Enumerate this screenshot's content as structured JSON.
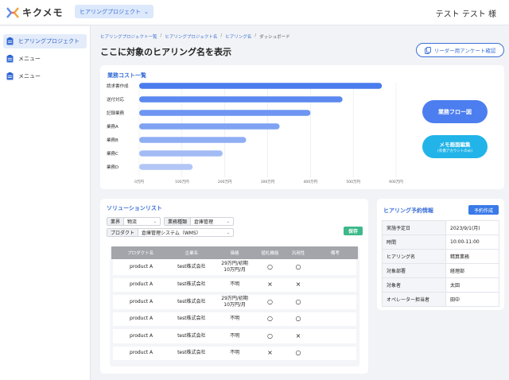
{
  "app": {
    "logo_text": "キクメモ",
    "project_select": "ヒアリングプロジェクト",
    "user_name": "テスト テスト 様"
  },
  "colors": {
    "accent": "#3a6fd8",
    "bar_dark": "#4a7cee",
    "bar_light": "#b3c7f6",
    "save_green": "#3db88a",
    "memo_cyan": "#22b4e8"
  },
  "sidebar": {
    "items": [
      {
        "label": "ヒアリングプロジェクト",
        "icon": "clipboard-icon",
        "active": true
      },
      {
        "label": "メニュー",
        "icon": "clipboard-icon",
        "active": false
      },
      {
        "label": "メニュー",
        "icon": "clipboard-icon",
        "active": false
      }
    ]
  },
  "breadcrumb": [
    "ヒアリングプロジェクト一覧",
    "ヒアリングプロジェクト名",
    "ヒアリング名",
    "ダッシュボード"
  ],
  "page_title": "ここに対象のヒアリング名を表示",
  "survey_button": "リーダー用アンケート確認",
  "cost_panel": {
    "title": "業務コスト一覧"
  },
  "chart_data": {
    "type": "bar",
    "orientation": "horizontal",
    "title": "業務コスト一覧",
    "categories": [
      "請求書作成",
      "送付対応",
      "記録業務",
      "業務A",
      "業務B",
      "業務C",
      "業務D"
    ],
    "values": [
      567,
      475,
      400,
      328,
      250,
      195,
      125
    ],
    "x_ticks": [
      "0万円",
      "100万円",
      "200万円",
      "300万円",
      "400万円",
      "500万円",
      "600万円"
    ],
    "xlim": [
      0,
      600
    ],
    "grid": true
  },
  "flow_button": "業務フロー図",
  "memo_button": {
    "main": "メモ画面編集",
    "sub": "(有償アカウントのみ)"
  },
  "solution": {
    "title": "ソリューションリスト",
    "filters": {
      "industry": {
        "label": "業界",
        "value": "物流"
      },
      "job_type": {
        "label": "業務種類",
        "value": "倉庫管理"
      },
      "product": {
        "label": "プロダクト",
        "value": "倉庫管理システム（WMS）"
      }
    },
    "save_label": "保存",
    "columns": [
      "プロダクト名",
      "企業名",
      "価格",
      "値札機能",
      "汎用性",
      "備考"
    ],
    "rows": [
      {
        "product": "product A",
        "company": "test株式会社",
        "price": "29万円/初期\n10万円/月",
        "tag": "○",
        "versatility": "○",
        "note": ""
      },
      {
        "product": "product A",
        "company": "test株式会社",
        "price": "不明",
        "tag": "×",
        "versatility": "×",
        "note": ""
      },
      {
        "product": "product A",
        "company": "test株式会社",
        "price": "29万円/初期\n10万円/月",
        "tag": "○",
        "versatility": "○",
        "note": ""
      },
      {
        "product": "product A",
        "company": "test株式会社",
        "price": "不明",
        "tag": "○",
        "versatility": "○",
        "note": ""
      },
      {
        "product": "product A",
        "company": "test株式会社",
        "price": "不明",
        "tag": "○",
        "versatility": "×",
        "note": ""
      },
      {
        "product": "product A",
        "company": "test株式会社",
        "price": "不明",
        "tag": "×",
        "versatility": "○",
        "note": ""
      }
    ]
  },
  "schedule": {
    "title": "ヒアリング予約情報",
    "button": "予約作成",
    "rows": [
      {
        "key": "実施予定日",
        "value": "2023/9/1(月)"
      },
      {
        "key": "時間",
        "value": "10:00-11:00"
      },
      {
        "key": "ヒアリング名",
        "value": "精算業務"
      },
      {
        "key": "対象部署",
        "value": "経理部"
      },
      {
        "key": "対象者",
        "value": "太田"
      },
      {
        "key": "オペレーター担当者",
        "value": "田中"
      }
    ]
  }
}
